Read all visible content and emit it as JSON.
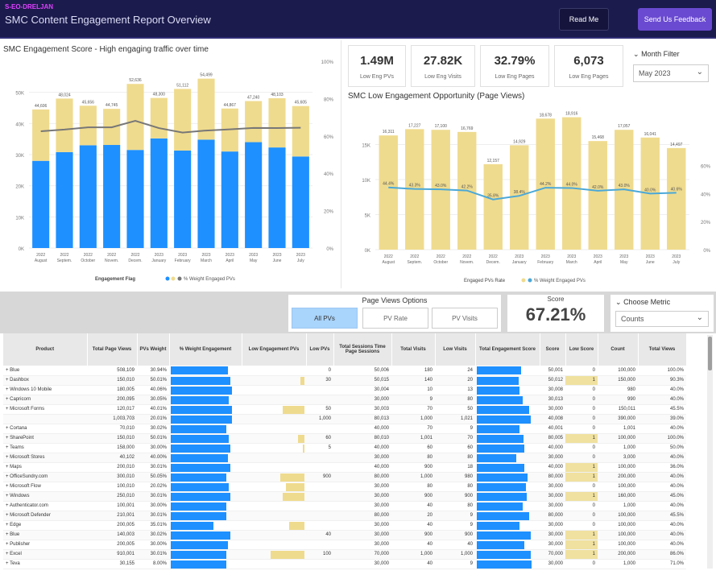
{
  "header": {
    "tag": "S-EO-DRELJAN",
    "title": "SMC Content Engagement Report Overview",
    "read_me_label": "Read Me",
    "feedback_label": "Send Us Feedback"
  },
  "colors": {
    "header_bg": "#1c1b4d",
    "blue": "#1e90ff",
    "gold": "#efdb8e",
    "line_grey": "#777777",
    "line_teal": "#4aa8d8"
  },
  "chart1": {
    "title": "SMC Engagement Score - High engaging traffic over time",
    "legend_label": "Engagement Flag",
    "legend_line": "% Weight Engaged PVs"
  },
  "chart2": {
    "title": "SMC Low Engagement Opportunity (Page Views)",
    "legend_label": "Engaged PVs Rate",
    "legend_line": "% Weight Engaged PVs"
  },
  "chart_data": [
    {
      "type": "bar",
      "stacked": true,
      "title": "SMC Engagement Score - High engaging traffic over time",
      "categories": [
        "2022 August",
        "2022 Septem.",
        "2022 October",
        "2022 Novem.",
        "2022 Decem.",
        "2023 January",
        "2023 February",
        "2023 March",
        "2023 April",
        "2023 May",
        "2023 June",
        "2023 July"
      ],
      "series": [
        {
          "name": "",
          "values": [
            28000,
            30800,
            33000,
            33100,
            31500,
            35200,
            31300,
            34800,
            31000,
            34000,
            32300,
            29400
          ]
        },
        {
          "name": "",
          "values": [
            16500,
            17200,
            12700,
            11600,
            21200,
            13000,
            19800,
            19600,
            13800,
            13200,
            15800,
            16200
          ]
        }
      ],
      "totals": [
        "44,606",
        "48,024",
        "45,656",
        "44,745",
        "52,636",
        "48,300",
        "51,112",
        "54,499",
        "44,867",
        "47,240",
        "48,103",
        "45,605"
      ],
      "secondary": {
        "name": "% Weight Engaged PVs",
        "values": [
          62.5,
          63.4,
          64.6,
          64.6,
          68.1,
          64.2,
          61.8,
          62.9,
          63.5,
          64.3,
          64.2,
          64.4
        ]
      },
      "ylim": [
        0,
        60000
      ],
      "y2lim": [
        0,
        100
      ],
      "yticks": [
        "0K",
        "10K",
        "20K",
        "30K",
        "40K",
        "50K"
      ],
      "y2ticks": [
        "0%",
        "20%",
        "40%",
        "60%",
        "80%",
        "100%"
      ]
    },
    {
      "type": "bar",
      "title": "SMC Low Engagement Opportunity (Page Views)",
      "categories": [
        "2022 August",
        "2022 Septem.",
        "2022 October",
        "2022 Novem.",
        "2022 Decem.",
        "2023 January",
        "2023 February",
        "2023 March",
        "2023 April",
        "2023 May",
        "2023 June",
        "2023 July"
      ],
      "values": [
        16300,
        17200,
        17100,
        16800,
        12200,
        14900,
        18700,
        18900,
        15500,
        17100,
        16000,
        14500
      ],
      "labels": [
        "16,311",
        "17,227",
        "17,100",
        "16,769",
        "12,157",
        "14,929",
        "18,678",
        "18,916",
        "15,468",
        "17,057",
        "16,041",
        "14,497"
      ],
      "secondary": {
        "name": "% Weight Engaged PVs",
        "values": [
          44.4,
          43.3,
          43.0,
          42.2,
          35.8,
          38.4,
          44.2,
          44.0,
          42.0,
          43.0,
          40.0,
          40.6
        ]
      },
      "secondary_labels": [
        "44.4%",
        "43.3%",
        "43.0%",
        "42.2%",
        "35.8%",
        "38.4%",
        "44.2%",
        "44.0%",
        "42.0%",
        "43.0%",
        "40.0%",
        "40.6%"
      ],
      "ylim": [
        0,
        20000
      ],
      "y2lim": [
        0,
        100
      ],
      "yticks": [
        "0K",
        "5K",
        "10K",
        "15K"
      ],
      "y2ticks": [
        "0%",
        "20%",
        "40%",
        "60%"
      ]
    }
  ],
  "kpis": [
    {
      "value": "1.49M",
      "label": "Low Eng PVs"
    },
    {
      "value": "27.82K",
      "label": "Low Eng Visits"
    },
    {
      "value": "32.79%",
      "label": "Low Eng Pages"
    },
    {
      "value": "6,073",
      "label": "Low Eng Pages"
    }
  ],
  "month_filter": {
    "label": "Month Filter",
    "value": "May 2023"
  },
  "page_views_options": {
    "title": "Page Views Options",
    "options": [
      "All PVs",
      "PV Rate",
      "PV Visits"
    ]
  },
  "score": {
    "label": "Score",
    "value": "67.21%"
  },
  "choose_metric": {
    "label": "Choose Metric",
    "value": "Counts"
  },
  "table": {
    "headers": [
      "Product",
      "Total Page Views",
      "PVs Weight",
      "% Weight Engagement",
      "Low Engagement PVs",
      "Low PVs",
      "Total Sessions Time Page Sessions",
      "Total Visits",
      "Low Visits",
      "Total Engagement Score",
      "Score",
      "Low Score",
      "Count",
      "Total Views"
    ],
    "rows": [
      [
        "Blue",
        "508,109",
        "30.94%",
        0.82,
        0.0,
        "0",
        "50,006",
        "180",
        "24",
        "0.72",
        "50,001",
        "0",
        "100,000",
        "100.0%"
      ],
      [
        "Dashbox",
        "150,010",
        "50.01%",
        0.86,
        0.07,
        "30",
        "50,015",
        "140",
        "20",
        "0.69",
        "50,012",
        "1",
        "150,000",
        "90.3%"
      ],
      [
        "Windows 10 Mobile",
        "180,005",
        "40.06%",
        0.88,
        0.0,
        "",
        "30,004",
        "10",
        "13",
        "0.70",
        "30,008",
        "0",
        "980",
        "40.0%"
      ],
      [
        "Capricorn",
        "200,095",
        "30.05%",
        0.84,
        0.0,
        "",
        "30,000",
        "9",
        "80",
        "0.75",
        "30,013",
        "0",
        "990",
        "40.0%"
      ],
      [
        "Microsoft Forms",
        "120,017",
        "40.01%",
        0.88,
        0.35,
        "50",
        "30,003",
        "70",
        "50",
        "0.85",
        "30,000",
        "0",
        "150,011",
        "45.5%"
      ],
      [
        "",
        "1,003,703",
        "20.01%",
        0.88,
        0.0,
        "1,000",
        "80,013",
        "1,000",
        "1,021",
        "0.88",
        "40,008",
        "0",
        "390,000",
        "39.0%"
      ],
      [
        "Cortana",
        "70,010",
        "30.02%",
        0.8,
        0.0,
        "",
        "40,000",
        "70",
        "9",
        "0.70",
        "40,001",
        "0",
        "1,001",
        "40.0%"
      ],
      [
        "SharePoint",
        "150,010",
        "50.01%",
        0.84,
        0.1,
        "60",
        "80,010",
        "1,001",
        "70",
        "0.76",
        "80,005",
        "1",
        "100,000",
        "100.0%"
      ],
      [
        "Teams",
        "158,000",
        "30.00%",
        0.86,
        0.03,
        "5",
        "40,000",
        "60",
        "60",
        "0.78",
        "40,000",
        "0",
        "1,000",
        "50.0%"
      ],
      [
        "Microsoft Stores",
        "40,102",
        "40.00%",
        0.82,
        0.0,
        "",
        "30,000",
        "80",
        "80",
        "0.65",
        "30,000",
        "0",
        "3,000",
        "40.0%"
      ],
      [
        "Maps",
        "200,010",
        "30.01%",
        0.86,
        0.0,
        "",
        "40,000",
        "900",
        "18",
        "0.78",
        "40,000",
        "1",
        "100,000",
        "36.0%"
      ],
      [
        "OfficeSundry.com",
        "300,010",
        "50.05%",
        0.8,
        0.4,
        "900",
        "80,000",
        "1,000",
        "980",
        "0.83",
        "80,000",
        "1",
        "200,000",
        "40.0%"
      ],
      [
        "Microsoft Flow",
        "100,010",
        "20.02%",
        0.84,
        0.3,
        "",
        "30,000",
        "80",
        "80",
        "0.80",
        "30,000",
        "0",
        "100,000",
        "40.0%"
      ],
      [
        "Windows",
        "250,010",
        "30.01%",
        0.86,
        0.35,
        "",
        "30,000",
        "900",
        "900",
        "0.82",
        "30,000",
        "1",
        "160,000",
        "45.0%"
      ],
      [
        "Authenticator.com",
        "100,001",
        "30.00%",
        0.8,
        0.0,
        "",
        "30,000",
        "40",
        "80",
        "0.75",
        "30,000",
        "0",
        "1,000",
        "40.0%"
      ],
      [
        "Microsoft Defender",
        "210,001",
        "30.01%",
        0.8,
        0.0,
        "",
        "80,000",
        "20",
        "9",
        "0.85",
        "80,000",
        "0",
        "100,000",
        "45.5%"
      ],
      [
        "Edge",
        "200,005",
        "35.01%",
        0.62,
        0.25,
        "",
        "30,000",
        "40",
        "9",
        "0.70",
        "30,000",
        "0",
        "100,000",
        "40.0%"
      ],
      [
        "Blue",
        "140,003",
        "30.02%",
        0.86,
        0.0,
        "40",
        "30,000",
        "900",
        "900",
        "0.88",
        "30,000",
        "1",
        "100,000",
        "40.0%"
      ],
      [
        "Publisher",
        "200,005",
        "30.00%",
        0.82,
        0.0,
        "",
        "30,000",
        "40",
        "40",
        "0.78",
        "30,000",
        "1",
        "100,000",
        "40.0%"
      ],
      [
        "Excel",
        "910,001",
        "30.01%",
        0.8,
        0.55,
        "100",
        "70,000",
        "1,000",
        "1,000",
        "0.88",
        "70,000",
        "1",
        "200,000",
        "86.0%"
      ],
      [
        "Teva",
        "30,155",
        "8.00%",
        0.8,
        0.0,
        "",
        "30,000",
        "40",
        "9",
        "0.90",
        "30,000",
        "0",
        "1,000",
        "71.0%"
      ]
    ]
  }
}
